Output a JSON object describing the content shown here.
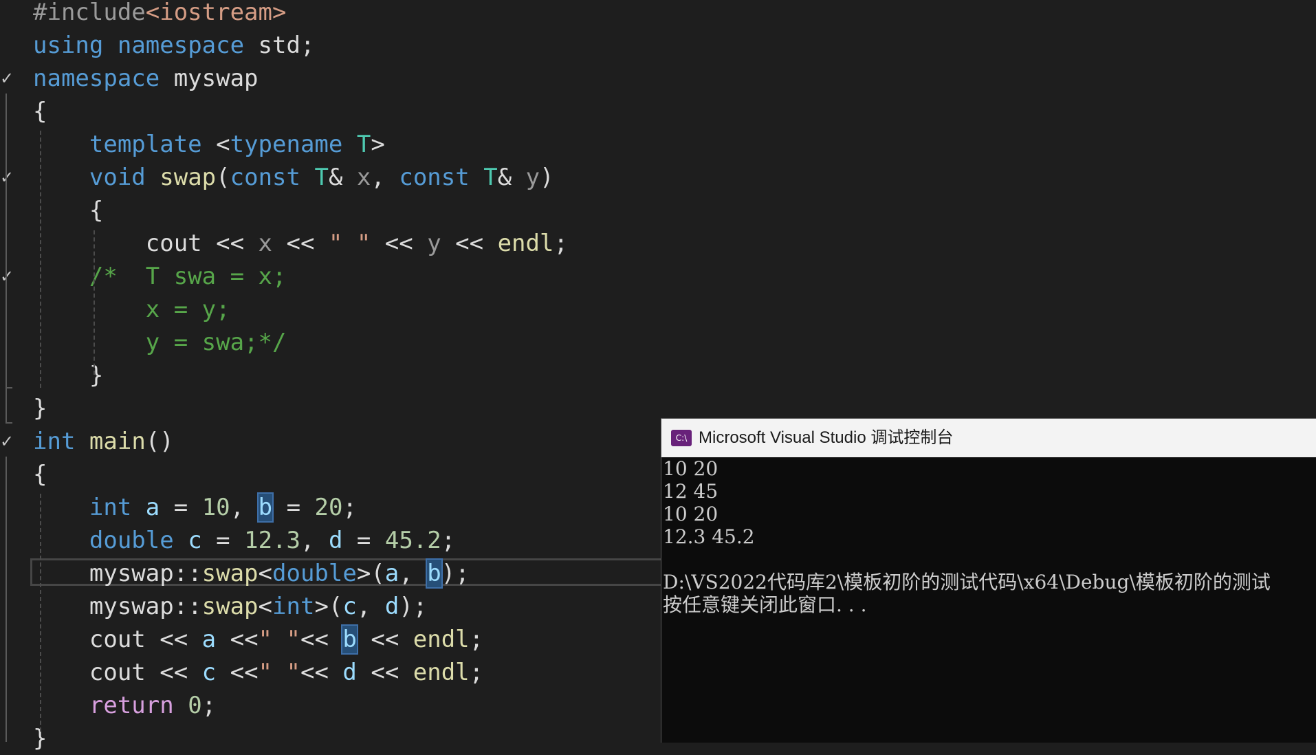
{
  "editor": {
    "lines": [
      {
        "gutter": "",
        "tokens": [
          {
            "c": "pp",
            "t": "#include"
          },
          {
            "c": "inc",
            "t": "<iostream>"
          }
        ]
      },
      {
        "gutter": "",
        "tokens": [
          {
            "c": "kw",
            "t": "using"
          },
          {
            "c": "plain",
            "t": " "
          },
          {
            "c": "kw",
            "t": "namespace"
          },
          {
            "c": "plain",
            "t": " std;"
          }
        ]
      },
      {
        "gutter": "✓",
        "tokens": [
          {
            "c": "kw",
            "t": "namespace"
          },
          {
            "c": "plain",
            "t": " myswap"
          }
        ]
      },
      {
        "gutter": "",
        "tokens": [
          {
            "c": "plain",
            "t": "{"
          }
        ]
      },
      {
        "gutter": "",
        "tokens": [
          {
            "c": "plain",
            "t": "    "
          },
          {
            "c": "kw",
            "t": "template"
          },
          {
            "c": "plain",
            "t": " <"
          },
          {
            "c": "kw",
            "t": "typename"
          },
          {
            "c": "plain",
            "t": " "
          },
          {
            "c": "ty",
            "t": "T"
          },
          {
            "c": "plain",
            "t": ">"
          }
        ]
      },
      {
        "gutter": "✓",
        "tokens": [
          {
            "c": "plain",
            "t": "    "
          },
          {
            "c": "kw",
            "t": "void"
          },
          {
            "c": "plain",
            "t": " "
          },
          {
            "c": "fn",
            "t": "swap"
          },
          {
            "c": "plain",
            "t": "("
          },
          {
            "c": "kw",
            "t": "const"
          },
          {
            "c": "plain",
            "t": " "
          },
          {
            "c": "ty",
            "t": "T"
          },
          {
            "c": "plain",
            "t": "& "
          },
          {
            "c": "prm",
            "t": "x"
          },
          {
            "c": "plain",
            "t": ", "
          },
          {
            "c": "kw",
            "t": "const"
          },
          {
            "c": "plain",
            "t": " "
          },
          {
            "c": "ty",
            "t": "T"
          },
          {
            "c": "plain",
            "t": "& "
          },
          {
            "c": "prm",
            "t": "y"
          },
          {
            "c": "plain",
            "t": ")"
          }
        ]
      },
      {
        "gutter": "",
        "tokens": [
          {
            "c": "plain",
            "t": "    {"
          }
        ]
      },
      {
        "gutter": "",
        "tokens": [
          {
            "c": "plain",
            "t": "        cout << "
          },
          {
            "c": "prm",
            "t": "x"
          },
          {
            "c": "plain",
            "t": " << "
          },
          {
            "c": "str",
            "t": "\" \""
          },
          {
            "c": "plain",
            "t": " << "
          },
          {
            "c": "prm",
            "t": "y"
          },
          {
            "c": "plain",
            "t": " << "
          },
          {
            "c": "fn",
            "t": "endl"
          },
          {
            "c": "plain",
            "t": ";"
          }
        ]
      },
      {
        "gutter": "✓",
        "tokens": [
          {
            "c": "plain",
            "t": "    "
          },
          {
            "c": "cm",
            "t": "/*  T swa = x;"
          }
        ]
      },
      {
        "gutter": "",
        "tokens": [
          {
            "c": "cm",
            "t": "        x = y;"
          }
        ]
      },
      {
        "gutter": "",
        "tokens": [
          {
            "c": "cm",
            "t": "        y = swa;*/"
          }
        ]
      },
      {
        "gutter": "",
        "tokens": [
          {
            "c": "plain",
            "t": "    }"
          }
        ]
      },
      {
        "gutter": "",
        "tokens": [
          {
            "c": "plain",
            "t": "}"
          }
        ]
      },
      {
        "gutter": "✓",
        "tokens": [
          {
            "c": "kw",
            "t": "int"
          },
          {
            "c": "plain",
            "t": " "
          },
          {
            "c": "fn",
            "t": "main"
          },
          {
            "c": "plain",
            "t": "()"
          }
        ]
      },
      {
        "gutter": "",
        "tokens": [
          {
            "c": "plain",
            "t": "{"
          }
        ]
      },
      {
        "gutter": "",
        "tokens": [
          {
            "c": "plain",
            "t": "    "
          },
          {
            "c": "kw",
            "t": "int"
          },
          {
            "c": "plain",
            "t": " "
          },
          {
            "c": "var",
            "t": "a"
          },
          {
            "c": "plain",
            "t": " = "
          },
          {
            "c": "num",
            "t": "10"
          },
          {
            "c": "plain",
            "t": ", "
          },
          {
            "c": "var hl",
            "t": "b"
          },
          {
            "c": "plain",
            "t": " = "
          },
          {
            "c": "num",
            "t": "20"
          },
          {
            "c": "plain",
            "t": ";"
          }
        ]
      },
      {
        "gutter": "",
        "tokens": [
          {
            "c": "plain",
            "t": "    "
          },
          {
            "c": "kw",
            "t": "double"
          },
          {
            "c": "plain",
            "t": " "
          },
          {
            "c": "var",
            "t": "c"
          },
          {
            "c": "plain",
            "t": " = "
          },
          {
            "c": "num",
            "t": "12.3"
          },
          {
            "c": "plain",
            "t": ", "
          },
          {
            "c": "var",
            "t": "d"
          },
          {
            "c": "plain",
            "t": " = "
          },
          {
            "c": "num",
            "t": "45.2"
          },
          {
            "c": "plain",
            "t": ";"
          }
        ]
      },
      {
        "gutter": "",
        "tokens": [
          {
            "c": "plain",
            "t": "    myswap::"
          },
          {
            "c": "fn",
            "t": "swap"
          },
          {
            "c": "plain",
            "t": "<"
          },
          {
            "c": "kw",
            "t": "double"
          },
          {
            "c": "plain",
            "t": ">("
          },
          {
            "c": "var",
            "t": "a"
          },
          {
            "c": "plain",
            "t": ", "
          },
          {
            "c": "var hl",
            "t": "b"
          },
          {
            "c": "plain",
            "t": ");"
          }
        ]
      },
      {
        "gutter": "",
        "tokens": [
          {
            "c": "plain",
            "t": "    myswap::"
          },
          {
            "c": "fn",
            "t": "swap"
          },
          {
            "c": "plain",
            "t": "<"
          },
          {
            "c": "kw",
            "t": "int"
          },
          {
            "c": "plain",
            "t": ">("
          },
          {
            "c": "var",
            "t": "c"
          },
          {
            "c": "plain",
            "t": ", "
          },
          {
            "c": "var",
            "t": "d"
          },
          {
            "c": "plain",
            "t": ");"
          }
        ]
      },
      {
        "gutter": "",
        "tokens": [
          {
            "c": "plain",
            "t": "    cout << "
          },
          {
            "c": "var",
            "t": "a"
          },
          {
            "c": "plain",
            "t": " <<"
          },
          {
            "c": "str",
            "t": "\" \""
          },
          {
            "c": "plain",
            "t": "<< "
          },
          {
            "c": "var hl",
            "t": "b"
          },
          {
            "c": "plain",
            "t": " << "
          },
          {
            "c": "fn",
            "t": "endl"
          },
          {
            "c": "plain",
            "t": ";"
          }
        ]
      },
      {
        "gutter": "",
        "tokens": [
          {
            "c": "plain",
            "t": "    cout << "
          },
          {
            "c": "var",
            "t": "c"
          },
          {
            "c": "plain",
            "t": " <<"
          },
          {
            "c": "str",
            "t": "\" \""
          },
          {
            "c": "plain",
            "t": "<< "
          },
          {
            "c": "var",
            "t": "d"
          },
          {
            "c": "plain",
            "t": " << "
          },
          {
            "c": "fn",
            "t": "endl"
          },
          {
            "c": "plain",
            "t": ";"
          }
        ]
      },
      {
        "gutter": "",
        "tokens": [
          {
            "c": "plain",
            "t": "    "
          },
          {
            "c": "ctl",
            "t": "return"
          },
          {
            "c": "plain",
            "t": " "
          },
          {
            "c": "num",
            "t": "0"
          },
          {
            "c": "plain",
            "t": ";"
          }
        ]
      },
      {
        "gutter": "",
        "tokens": [
          {
            "c": "plain",
            "t": "}"
          }
        ]
      }
    ]
  },
  "console": {
    "icon_label": "C:\\",
    "title": "Microsoft Visual Studio 调试控制台",
    "output": [
      "10 20",
      "12 45",
      "10 20",
      "12.3 45.2",
      "",
      "D:\\VS2022代码库2\\模板初阶的测试代码\\x64\\Debug\\模板初阶的测试",
      "按任意键关闭此窗口. . ."
    ]
  },
  "colors": {
    "editor_background": "#1e1e1e",
    "keyword": "#569cd6",
    "type": "#4ec9b0",
    "function": "#dcdcaa",
    "string": "#d69d85",
    "number": "#b5cea8",
    "comment": "#57a64a",
    "variable": "#9cdcfe",
    "control_keyword": "#d8a0df",
    "console_background": "#0c0c0c",
    "console_titlebar": "#f3f3f3"
  }
}
